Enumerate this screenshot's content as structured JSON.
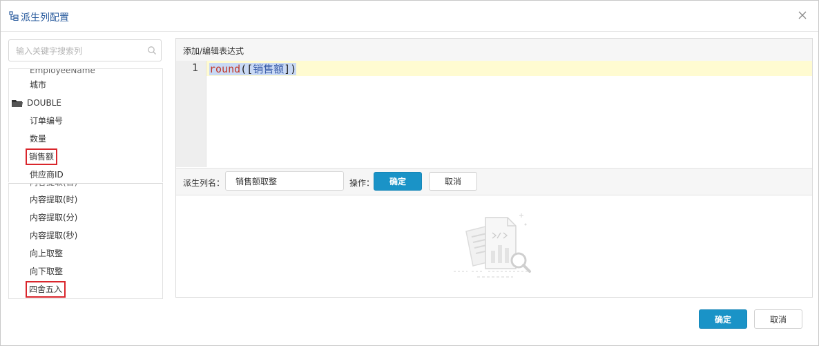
{
  "dialog": {
    "title": "派生列配置"
  },
  "search": {
    "placeholder": "输入关键字搜索列"
  },
  "field_list": {
    "partial_top": "EmployeeName",
    "items": [
      "城市"
    ],
    "group": "DOUBLE",
    "group_items": [
      "订单编号",
      "数量",
      "销售额",
      "供应商ID"
    ]
  },
  "func_list": {
    "partial_top": "内容提取(日)",
    "items": [
      "内容提取(时)",
      "内容提取(分)",
      "内容提取(秒)",
      "向上取整",
      "向下取整",
      "四舍五入"
    ]
  },
  "editor": {
    "header": "添加/编辑表达式",
    "line_number": "1",
    "code_func": "round",
    "code_open": "([",
    "code_field": "销售额",
    "code_close": "])"
  },
  "name_bar": {
    "label": "派生列名：",
    "value": "销售额取整",
    "op_label": "操作：",
    "confirm": "确定",
    "cancel": "取消"
  },
  "footer": {
    "confirm": "确定",
    "cancel": "取消"
  },
  "colors": {
    "primary": "#1a93c7",
    "highlight_box": "#d9262c",
    "title": "#2b5c9e",
    "code_func": "#c0392b",
    "line_highlight": "#fffbd1"
  }
}
